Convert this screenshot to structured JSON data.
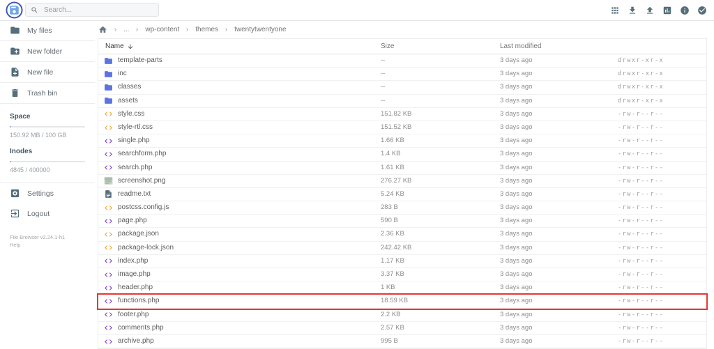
{
  "colors": {
    "accent": "#546e7a",
    "folder": "#5b74e0",
    "code-amber": "#eaa636",
    "code-purple": "#7d3fc8",
    "highlight": "#e8382f",
    "progress": "#4667d2",
    "logo-ring": "#3f51b5",
    "logo-fill": "#6ea6e8"
  },
  "header": {
    "search_placeholder": "Search...",
    "icons": [
      "grid-view-icon",
      "download-icon",
      "upload-icon",
      "stats-icon",
      "info-icon",
      "select-multiple-icon"
    ]
  },
  "sidebar": {
    "items": [
      {
        "label": "My files",
        "icon": "folder-icon"
      },
      {
        "label": "New folder",
        "icon": "new-folder-icon"
      },
      {
        "label": "New file",
        "icon": "new-file-icon"
      },
      {
        "label": "Trash bin",
        "icon": "trash-icon"
      }
    ],
    "usage": {
      "space": {
        "label": "Space",
        "value": "150.92 MB / 100 GB",
        "percent": 0.5
      },
      "inodes": {
        "label": "Inodes",
        "value": "4845 / 400000",
        "percent": 1.2
      }
    },
    "actions": [
      {
        "label": "Settings",
        "icon": "settings-icon"
      },
      {
        "label": "Logout",
        "icon": "logout-icon"
      }
    ],
    "footer": {
      "version": "File Browser v2.24.1-h1",
      "help": "Help"
    }
  },
  "breadcrumb": {
    "home_icon": "home-icon",
    "segments": [
      "...",
      "wp-content",
      "themes",
      "twentytwentyone"
    ]
  },
  "table": {
    "headers": {
      "name": "Name",
      "size": "Size",
      "modified": "Last modified"
    },
    "sort_icon": "arrow-down-icon",
    "rows": [
      {
        "name": "template-parts",
        "icon": "folder-icon",
        "size": "--",
        "modified": "3 days ago",
        "perms": "drwxr-xr-x"
      },
      {
        "name": "inc",
        "icon": "folder-icon",
        "size": "--",
        "modified": "3 days ago",
        "perms": "drwxr-xr-x"
      },
      {
        "name": "classes",
        "icon": "folder-icon",
        "size": "--",
        "modified": "3 days ago",
        "perms": "drwxr-xr-x"
      },
      {
        "name": "assets",
        "icon": "folder-icon",
        "size": "--",
        "modified": "3 days ago",
        "perms": "drwxr-xr-x"
      },
      {
        "name": "style.css",
        "icon": "code-amber-icon",
        "size": "151.82 KB",
        "modified": "3 days ago",
        "perms": "-rw-r--r--"
      },
      {
        "name": "style-rtl.css",
        "icon": "code-amber-icon",
        "size": "151.52 KB",
        "modified": "3 days ago",
        "perms": "-rw-r--r--"
      },
      {
        "name": "single.php",
        "icon": "code-purple-icon",
        "size": "1.66 KB",
        "modified": "3 days ago",
        "perms": "-rw-r--r--"
      },
      {
        "name": "searchform.php",
        "icon": "code-purple-icon",
        "size": "1.4 KB",
        "modified": "3 days ago",
        "perms": "-rw-r--r--"
      },
      {
        "name": "search.php",
        "icon": "code-purple-icon",
        "size": "1.61 KB",
        "modified": "3 days ago",
        "perms": "-rw-r--r--"
      },
      {
        "name": "screenshot.png",
        "icon": "image-thumbnail-icon",
        "size": "276.27 KB",
        "modified": "3 days ago",
        "perms": "-rw-r--r--"
      },
      {
        "name": "readme.txt",
        "icon": "text-file-icon",
        "size": "5.24 KB",
        "modified": "3 days ago",
        "perms": "-rw-r--r--"
      },
      {
        "name": "postcss.config.js",
        "icon": "code-amber-icon",
        "size": "283 B",
        "modified": "3 days ago",
        "perms": "-rw-r--r--"
      },
      {
        "name": "page.php",
        "icon": "code-purple-icon",
        "size": "590 B",
        "modified": "3 days ago",
        "perms": "-rw-r--r--"
      },
      {
        "name": "package.json",
        "icon": "code-amber-icon",
        "size": "2.36 KB",
        "modified": "3 days ago",
        "perms": "-rw-r--r--"
      },
      {
        "name": "package-lock.json",
        "icon": "code-amber-icon",
        "size": "242.42 KB",
        "modified": "3 days ago",
        "perms": "-rw-r--r--"
      },
      {
        "name": "index.php",
        "icon": "code-purple-icon",
        "size": "1.17 KB",
        "modified": "3 days ago",
        "perms": "-rw-r--r--"
      },
      {
        "name": "image.php",
        "icon": "code-purple-icon",
        "size": "3.37 KB",
        "modified": "3 days ago",
        "perms": "-rw-r--r--"
      },
      {
        "name": "header.php",
        "icon": "code-purple-icon",
        "size": "1 KB",
        "modified": "3 days ago",
        "perms": "-rw-r--r--"
      },
      {
        "name": "functions.php",
        "icon": "code-purple-icon",
        "size": "18.59 KB",
        "modified": "3 days ago",
        "perms": "-rw-r--r--",
        "highlighted": true
      },
      {
        "name": "footer.php",
        "icon": "code-purple-icon",
        "size": "2.2 KB",
        "modified": "3 days ago",
        "perms": "-rw-r--r--"
      },
      {
        "name": "comments.php",
        "icon": "code-purple-icon",
        "size": "2.57 KB",
        "modified": "3 days ago",
        "perms": "-rw-r--r--"
      },
      {
        "name": "archive.php",
        "icon": "code-purple-icon",
        "size": "995 B",
        "modified": "3 days ago",
        "perms": "-rw-r--r--"
      }
    ]
  }
}
